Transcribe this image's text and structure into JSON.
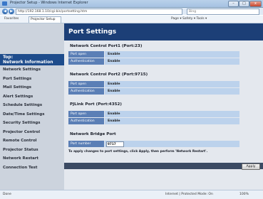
{
  "window": {
    "title": "Projector Setup - Windows Internet Explorer",
    "min": "–",
    "max": "□",
    "close": "x"
  },
  "address": {
    "url": "http://192.168.1.10/cgi-bin/portsetting.htm",
    "search_placeholder": "Bing"
  },
  "favorites": {
    "label": "Favorites",
    "tab": "Projector Setup",
    "tools": "Page ▾  Safety ▾  Tools ▾"
  },
  "sidebar": {
    "header": "Top:\nNetwork Information",
    "items": [
      "Network Settings",
      "Port Settings",
      "Mail Settings",
      "Alert Settings",
      "Schedule Settings",
      "Date/Time Settings",
      "Security Settings",
      "Projector Control",
      "Remote Control",
      "Projector Status",
      "Network Restart",
      "Connection Test"
    ]
  },
  "main": {
    "title": "Port Settings",
    "sections": [
      {
        "title": "Network Control Port1 (Port:23)",
        "rows": [
          {
            "label": "Port open",
            "value": "Enable"
          },
          {
            "label": "Authentication",
            "value": "Enable"
          }
        ]
      },
      {
        "title": "Network Control Port2 (Port:9715)",
        "rows": [
          {
            "label": "Port open",
            "value": "Enable"
          },
          {
            "label": "Authentication",
            "value": "Enable"
          }
        ]
      },
      {
        "title": "PJLink Port (Port:4352)",
        "rows": [
          {
            "label": "Port open",
            "value": "Enable"
          },
          {
            "label": "Authentication",
            "value": "Enable"
          }
        ]
      }
    ],
    "bridge": {
      "title": "Network Bridge Port",
      "label": "Port number",
      "value": "9717"
    },
    "note": "To apply changes to port settings, click Apply, then perform 'Network Restart'.",
    "apply_label": "Apply"
  },
  "status": {
    "left": "Done",
    "zone": "Internet | Protected Mode: On",
    "zoom": "100%"
  },
  "colors": {
    "nav_header": "#1e4c8c",
    "title_bar": "#1c3f77",
    "row_label": "#5b7fb6",
    "row_value": "#bcd2ec"
  }
}
